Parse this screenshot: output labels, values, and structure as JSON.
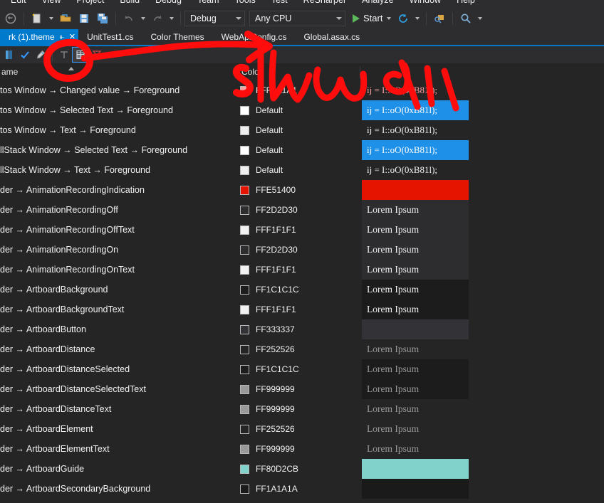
{
  "window": {
    "menu": [
      "Edit",
      "View",
      "Project",
      "Build",
      "Debug",
      "Team",
      "Tools",
      "Test",
      "ReSharper",
      "Analyze",
      "Window",
      "Help"
    ]
  },
  "toolbar": {
    "configuration": "Debug",
    "platform": "Any CPU",
    "start_label": "Start",
    "icons": [
      "navigate-back-icon",
      "new-item-icon",
      "open-file-icon",
      "save-icon",
      "save-all-icon",
      "undo-icon",
      "redo-icon",
      "start-debug-icon",
      "refresh-icon",
      "attach-process-icon",
      "find-icon"
    ]
  },
  "tabs": [
    {
      "label": "rk (1).theme",
      "active": true,
      "pin": "⫦",
      "close": "✕"
    },
    {
      "label": "UnitTest1.cs",
      "active": false
    },
    {
      "label": "Color Themes",
      "active": false
    },
    {
      "label": "WebApiConfig.cs",
      "active": false
    },
    {
      "label": "Global.asax.cs",
      "active": false
    }
  ],
  "grid": {
    "headers": {
      "name": "ame",
      "color": "Colo",
      "preview": ""
    },
    "rows": [
      {
        "name": "tos Window → Changed value → Foreground",
        "hex": "FFF7A1A1",
        "swatch": "#F7A1A1",
        "preview_text": "ij = I::oO(0xB81l);",
        "preview_kind": "code",
        "preview_fg": "#F7A1A1",
        "preview_bg": "transparent"
      },
      {
        "name": "tos Window → Selected Text → Foreground",
        "hex": "Default",
        "swatch": "#FFFFFF",
        "preview_text": "ij = I::oO(0xB81l);",
        "preview_kind": "code",
        "preview_fg": "#FFFFFF",
        "preview_bg": "#1E90E8"
      },
      {
        "name": "tos Window → Text → Foreground",
        "hex": "Default",
        "swatch": "#EFEFEF",
        "preview_text": "ij = I::oO(0xB81l);",
        "preview_kind": "code",
        "preview_fg": "#F1F1F1",
        "preview_bg": "transparent"
      },
      {
        "name": "llStack Window → Selected Text → Foreground",
        "hex": "Default",
        "swatch": "#FFFFFF",
        "preview_text": "ij = I::oO(0xB81l);",
        "preview_kind": "code",
        "preview_fg": "#FFFFFF",
        "preview_bg": "#1E90E8"
      },
      {
        "name": "llStack Window → Text → Foreground",
        "hex": "Default",
        "swatch": "#EFEFEF",
        "preview_text": "ij = I::oO(0xB81l);",
        "preview_kind": "code",
        "preview_fg": "#F1F1F1",
        "preview_bg": "transparent"
      },
      {
        "name": "der → AnimationRecordingIndication",
        "hex": "FFE51400",
        "swatch": "#E51400",
        "preview_text": "",
        "preview_kind": "block",
        "preview_fg": "#FFFFFF",
        "preview_bg": "#E51400"
      },
      {
        "name": "der → AnimationRecordingOff",
        "hex": "FF2D2D30",
        "swatch": "#2D2D30",
        "preview_text": "Lorem Ipsum",
        "preview_kind": "lorem",
        "preview_fg": "#F1F1F1",
        "preview_bg": "#2D2D30"
      },
      {
        "name": "der → AnimationRecordingOffText",
        "hex": "FFF1F1F1",
        "swatch": "#F1F1F1",
        "preview_text": "Lorem Ipsum",
        "preview_kind": "lorem",
        "preview_fg": "#F1F1F1",
        "preview_bg": "#2D2D30"
      },
      {
        "name": "der → AnimationRecordingOn",
        "hex": "FF2D2D30",
        "swatch": "#2D2D30",
        "preview_text": "Lorem Ipsum",
        "preview_kind": "lorem",
        "preview_fg": "#F1F1F1",
        "preview_bg": "#2D2D30"
      },
      {
        "name": "der → AnimationRecordingOnText",
        "hex": "FFF1F1F1",
        "swatch": "#F1F1F1",
        "preview_text": "Lorem Ipsum",
        "preview_kind": "lorem",
        "preview_fg": "#F1F1F1",
        "preview_bg": "#2D2D30"
      },
      {
        "name": "der → ArtboardBackground",
        "hex": "FF1C1C1C",
        "swatch": "#1C1C1C",
        "preview_text": "Lorem Ipsum",
        "preview_kind": "lorem",
        "preview_fg": "#F1F1F1",
        "preview_bg": "#1C1C1C"
      },
      {
        "name": "der → ArtboardBackgroundText",
        "hex": "FFF1F1F1",
        "swatch": "#F1F1F1",
        "preview_text": "Lorem Ipsum",
        "preview_kind": "lorem",
        "preview_fg": "#F1F1F1",
        "preview_bg": "#1C1C1C"
      },
      {
        "name": "der → ArtboardButton",
        "hex": "FF333337",
        "swatch": "#333337",
        "preview_text": "",
        "preview_kind": "block",
        "preview_fg": "#F1F1F1",
        "preview_bg": "#333337"
      },
      {
        "name": "der → ArtboardDistance",
        "hex": "FF252526",
        "swatch": "#252526",
        "preview_text": "Lorem Ipsum",
        "preview_kind": "lorem",
        "preview_fg": "#999999",
        "preview_bg": "#252526"
      },
      {
        "name": "der → ArtboardDistanceSelected",
        "hex": "FF1C1C1C",
        "swatch": "#1C1C1C",
        "preview_text": "Lorem Ipsum",
        "preview_kind": "lorem",
        "preview_fg": "#999999",
        "preview_bg": "#1C1C1C"
      },
      {
        "name": "der → ArtboardDistanceSelectedText",
        "hex": "FF999999",
        "swatch": "#999999",
        "preview_text": "Lorem Ipsum",
        "preview_kind": "lorem",
        "preview_fg": "#999999",
        "preview_bg": "#1C1C1C"
      },
      {
        "name": "der → ArtboardDistanceText",
        "hex": "FF999999",
        "swatch": "#999999",
        "preview_text": "Lorem Ipsum",
        "preview_kind": "lorem",
        "preview_fg": "#999999",
        "preview_bg": "#252526"
      },
      {
        "name": "der → ArtboardElement",
        "hex": "FF252526",
        "swatch": "#252526",
        "preview_text": "Lorem Ipsum",
        "preview_kind": "lorem",
        "preview_fg": "#999999",
        "preview_bg": "#252526"
      },
      {
        "name": "der → ArtboardElementText",
        "hex": "FF999999",
        "swatch": "#999999",
        "preview_text": "Lorem Ipsum",
        "preview_kind": "lorem",
        "preview_fg": "#999999",
        "preview_bg": "#252526"
      },
      {
        "name": "der → ArtboardGuide",
        "hex": "FF80D2CB",
        "swatch": "#80D2CB",
        "preview_text": "",
        "preview_kind": "block",
        "preview_fg": "#1C1C1C",
        "preview_bg": "#80D2CB"
      },
      {
        "name": "der → ArtboardSecondaryBackground",
        "hex": "FF1A1A1A",
        "swatch": "#1A1A1A",
        "preview_text": "",
        "preview_kind": "block",
        "preview_fg": "#F1F1F1",
        "preview_bg": "#1A1A1A"
      }
    ]
  },
  "annotation": {
    "ink_color": "#FF0C0C",
    "strokes": [
      "circle-around-grid-button",
      "arrow-to-right",
      "handwritten-show",
      "handwritten-all"
    ]
  }
}
